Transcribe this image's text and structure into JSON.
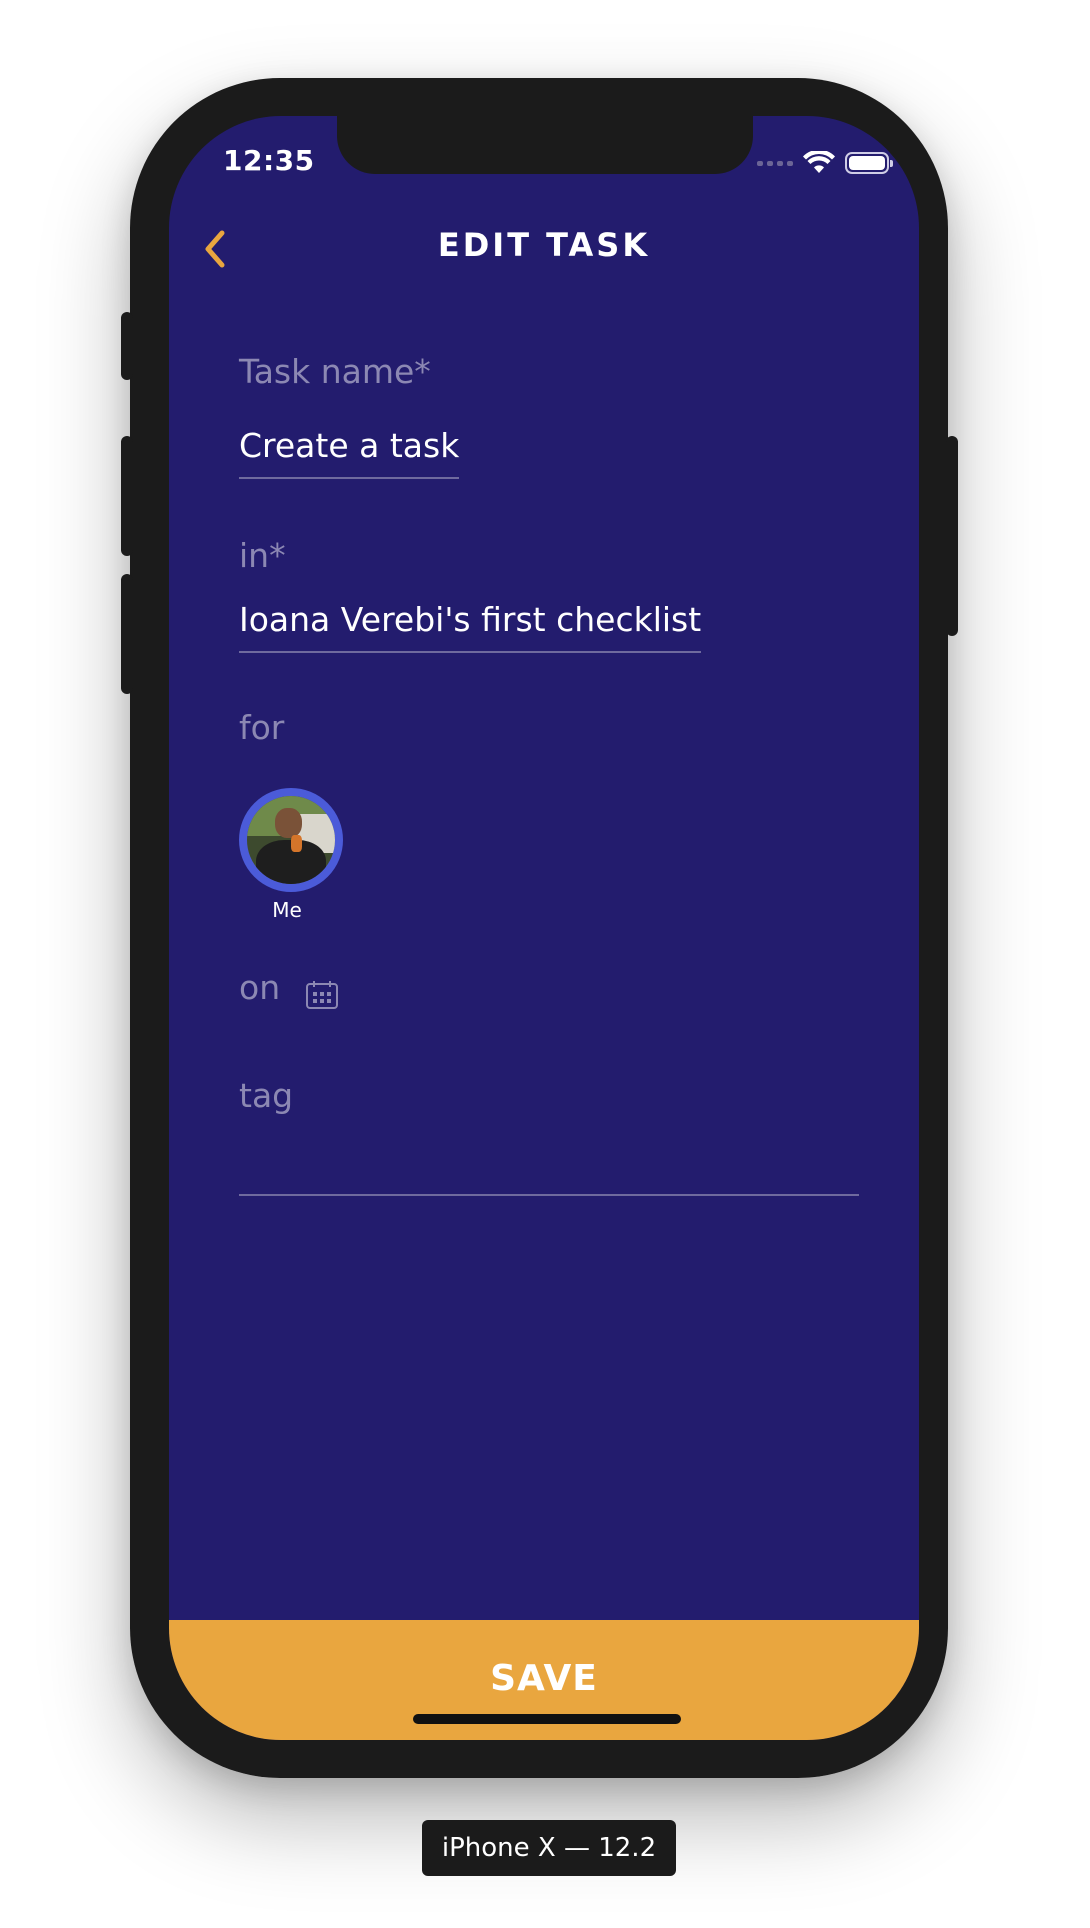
{
  "status_bar": {
    "time": "12:35"
  },
  "header": {
    "back_icon": "chevron-left-icon",
    "title": "EDIT TASK"
  },
  "form": {
    "task_name": {
      "label": "Task name*",
      "value": "Create a task"
    },
    "in": {
      "label": "in*",
      "value": "Ioana Verebi's first checklist"
    },
    "for": {
      "label": "for",
      "assignee_label": "Me"
    },
    "on": {
      "label": "on",
      "icon": "calendar-icon"
    },
    "tag": {
      "label": "tag",
      "value": ""
    }
  },
  "footer": {
    "save_label": "SAVE"
  },
  "device": {
    "label": "iPhone X — 12.2"
  },
  "colors": {
    "background": "#231c6e",
    "accent": "#e9a63f",
    "avatar_ring": "#4b5bd9",
    "label": "#8c88b3"
  }
}
